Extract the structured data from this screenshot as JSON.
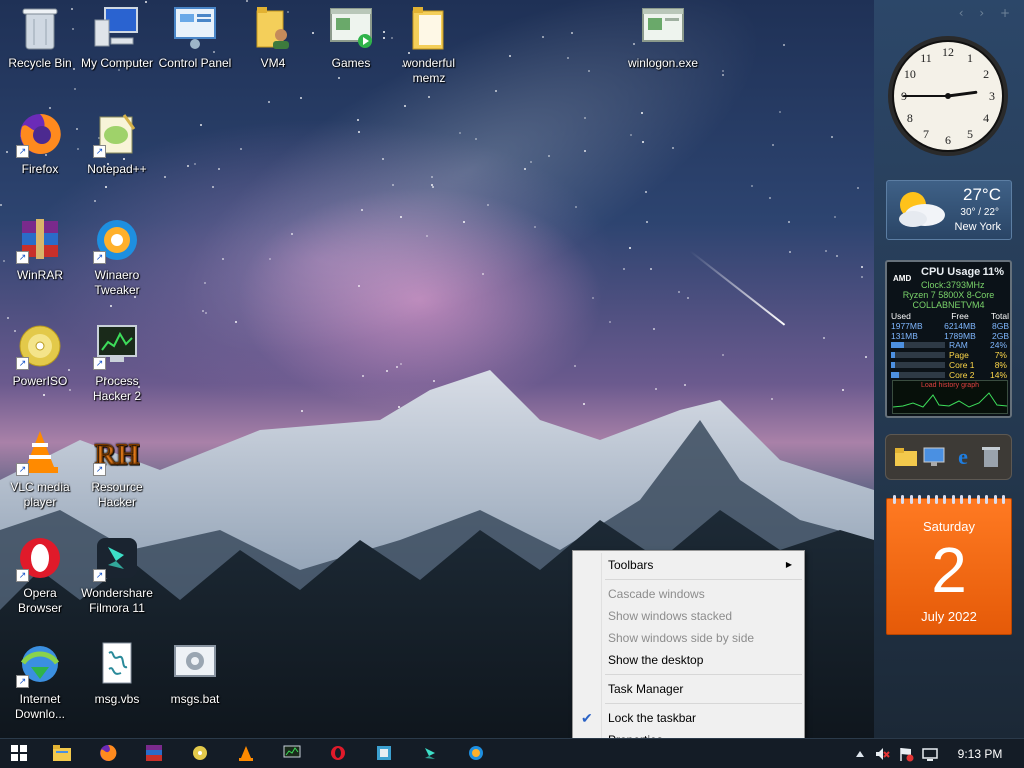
{
  "desktop": {
    "icons": [
      {
        "id": "recycle-bin",
        "label": "Recycle Bin",
        "icon": "recycle-bin-icon"
      },
      {
        "id": "my-computer",
        "label": "My Computer",
        "icon": "computer-icon"
      },
      {
        "id": "control-panel",
        "label": "Control Panel",
        "icon": "control-panel-icon"
      },
      {
        "id": "vm4",
        "label": "VM4",
        "icon": "user-folder-icon"
      },
      {
        "id": "games",
        "label": "Games",
        "icon": "games-window-icon"
      },
      {
        "id": "wonderful-memz",
        "label": "wonderful memz",
        "icon": "folder-icon"
      },
      {
        "id": "winlogon",
        "label": "winlogon.exe",
        "icon": "exe-window-icon"
      },
      {
        "id": "firefox",
        "label": "Firefox",
        "icon": "firefox-icon"
      },
      {
        "id": "notepadpp",
        "label": "Notepad++",
        "icon": "notepadpp-icon"
      },
      {
        "id": "winrar",
        "label": "WinRAR",
        "icon": "winrar-icon"
      },
      {
        "id": "winaero",
        "label": "Winaero Tweaker",
        "icon": "winaero-icon"
      },
      {
        "id": "poweriso",
        "label": "PowerISO",
        "icon": "poweriso-icon"
      },
      {
        "id": "processhacker",
        "label": "Process Hacker 2",
        "icon": "process-hacker-icon"
      },
      {
        "id": "vlc",
        "label": "VLC media player",
        "icon": "vlc-icon"
      },
      {
        "id": "resourcehacker",
        "label": "Resource Hacker",
        "icon": "resource-hacker-icon"
      },
      {
        "id": "opera",
        "label": "Opera Browser",
        "icon": "opera-icon"
      },
      {
        "id": "filmora",
        "label": "Wondershare Filmora 11",
        "icon": "filmora-icon"
      },
      {
        "id": "idm",
        "label": "Internet Downlo...",
        "icon": "idm-icon"
      },
      {
        "id": "msgvbs",
        "label": "msg.vbs",
        "icon": "script-icon"
      },
      {
        "id": "msgsbat",
        "label": "msgs.bat",
        "icon": "batch-gear-icon"
      }
    ]
  },
  "gadgets": {
    "clock": {
      "hour": 2,
      "minute": 45
    },
    "weather": {
      "temp": "27°C",
      "range": "30° / 22°",
      "city": "New York"
    },
    "cpu": {
      "title": "CPU Usage",
      "percent": "11%",
      "brand": "AMD",
      "clock": "Clock:3793MHz",
      "model": "Ryzen 7 5800X 8-Core",
      "host": "COLLABNETVM4",
      "headers": [
        "Used",
        "Free",
        "Total"
      ],
      "rows": [
        [
          "1977MB",
          "6214MB",
          "8GB"
        ],
        [
          "131MB",
          "1789MB",
          "2GB"
        ]
      ],
      "meters": [
        {
          "label": "RAM",
          "value": "24%",
          "fraction": 0.24
        },
        {
          "label": "Page",
          "value": "7%",
          "fraction": 0.07
        },
        {
          "label": "Core 1",
          "value": "8%",
          "fraction": 0.08
        },
        {
          "label": "Core 2",
          "value": "14%",
          "fraction": 0.14
        }
      ],
      "graph_caption": "Load history graph"
    },
    "calendar": {
      "weekday": "Saturday",
      "day": "2",
      "month_year": "July 2022"
    }
  },
  "context_menu": {
    "items": [
      {
        "label": "Toolbars",
        "submenu": true,
        "disabled": false
      },
      {
        "label": "Cascade windows",
        "disabled": true
      },
      {
        "label": "Show windows stacked",
        "disabled": true
      },
      {
        "label": "Show windows side by side",
        "disabled": true
      },
      {
        "label": "Show the desktop",
        "disabled": false
      },
      {
        "label": "Task Manager",
        "disabled": false
      },
      {
        "label": "Lock the taskbar",
        "checked": true,
        "disabled": false
      },
      {
        "label": "Properties",
        "disabled": false
      }
    ]
  },
  "taskbar": {
    "time": "9:13 PM",
    "pinned": [
      "start-icon",
      "explorer-icon",
      "firefox-icon",
      "winrar-icon",
      "poweriso-icon",
      "vlc-icon",
      "process-hacker-icon",
      "opera-icon",
      "resource-hacker-icon",
      "filmora-icon",
      "winaero-icon"
    ]
  },
  "colors": {
    "accent": "#2a62c5",
    "calendar": "#f06a14",
    "taskbar": "#141c26"
  }
}
